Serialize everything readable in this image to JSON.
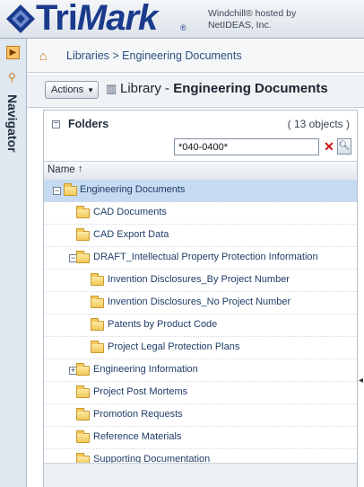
{
  "brand": {
    "logo_text_tri": "Tri",
    "logo_text_mark": "Mark",
    "registered": "®",
    "hosted_line1": "Windchill® hosted by",
    "hosted_line2": "NetIDEAS, Inc."
  },
  "navigator": {
    "label": "Navigator"
  },
  "breadcrumb": {
    "text": "Libraries > Engineering Documents"
  },
  "header": {
    "actions_label": "Actions",
    "title_prefix": "Library - ",
    "title_main": "Engineering Documents"
  },
  "folders_panel": {
    "title": "Folders",
    "count": "( 13 objects )",
    "filter_value": "*040-0400*",
    "column_name": "Name",
    "rows": [
      {
        "label": "Engineering Documents",
        "level": 0,
        "toggle": "−",
        "selected": true,
        "open": true
      },
      {
        "label": "CAD Documents",
        "level": 1,
        "toggle": "",
        "selected": false
      },
      {
        "label": "CAD Export Data",
        "level": 1,
        "toggle": "",
        "selected": false
      },
      {
        "label": "DRAFT_Intellectual Property Protection Information",
        "level": 1,
        "toggle": "−",
        "selected": false
      },
      {
        "label": "Invention Disclosures_By Project Number",
        "level": 2,
        "toggle": "",
        "selected": false
      },
      {
        "label": "Invention Disclosures_No Project Number",
        "level": 2,
        "toggle": "",
        "selected": false
      },
      {
        "label": "Patents by Product Code",
        "level": 2,
        "toggle": "",
        "selected": false
      },
      {
        "label": "Project Legal Protection Plans",
        "level": 2,
        "toggle": "",
        "selected": false
      },
      {
        "label": "Engineering Information",
        "level": 1,
        "toggle": "+",
        "selected": false
      },
      {
        "label": "Project Post Mortems",
        "level": 1,
        "toggle": "",
        "selected": false
      },
      {
        "label": "Promotion Requests",
        "level": 1,
        "toggle": "",
        "selected": false
      },
      {
        "label": "Reference Materials",
        "level": 1,
        "toggle": "",
        "selected": false
      },
      {
        "label": "Supporting Documentation",
        "level": 1,
        "toggle": "",
        "selected": false
      }
    ]
  },
  "colors": {
    "brand_blue": "#1a3a8c",
    "link_blue": "#1f3d67",
    "selected_row": "#c6daf1",
    "clear_red": "#cc1111"
  }
}
